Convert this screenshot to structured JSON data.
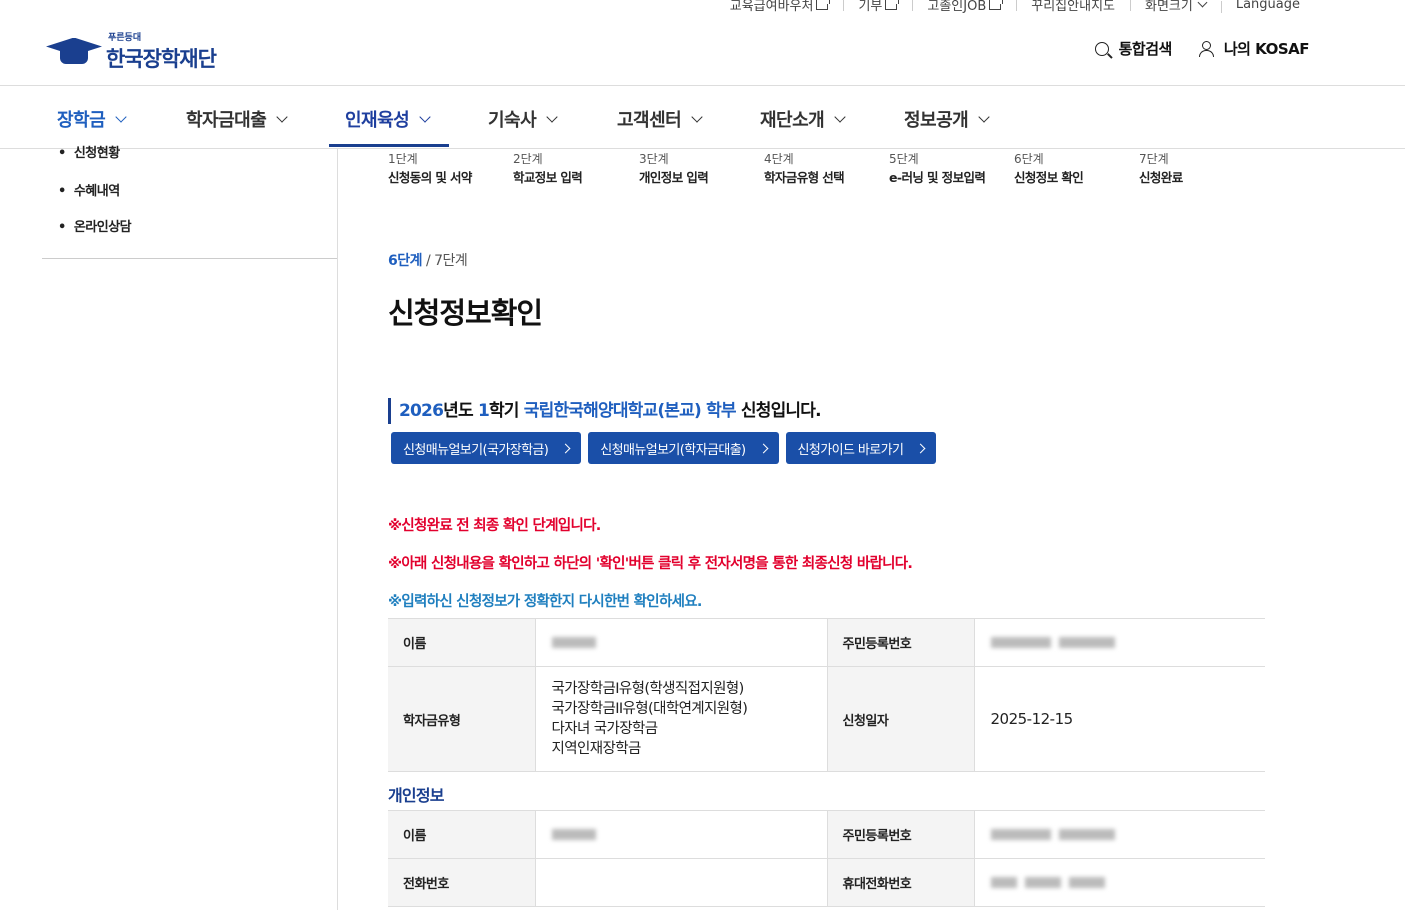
{
  "util_links": {
    "voucher": "교육급여바우처",
    "donate": "기부",
    "job": "고졸인JOB",
    "dreamhouse": "꾸리집안내지도",
    "screen_size": "화면크기",
    "language": "Language"
  },
  "logo": {
    "small": "푸른등대",
    "big": "한국장학재단"
  },
  "header": {
    "search": "통합검색",
    "my": "나의 KOSAF"
  },
  "gnb": {
    "scholarship": "장학금",
    "loan": "학자금대출",
    "talent": "인재육성",
    "dorm": "기숙사",
    "customer": "고객센터",
    "about": "재단소개",
    "disclosure": "정보공개"
  },
  "lnb": {
    "status": "신청현황",
    "benefits": "수혜내역",
    "consult": "온라인상담"
  },
  "steps": [
    {
      "n": "1단계",
      "t": "신청동의 및 서약"
    },
    {
      "n": "2단계",
      "t": "학교정보 입력"
    },
    {
      "n": "3단계",
      "t": "개인정보 입력"
    },
    {
      "n": "4단계",
      "t": "학자금유형 선택"
    },
    {
      "n": "5단계",
      "t": "e-러닝 및 정보입력"
    },
    {
      "n": "6단계",
      "t": "신청정보 확인"
    },
    {
      "n": "7단계",
      "t": "신청완료"
    }
  ],
  "step_indicator": {
    "current": "6단계",
    "total": "/ 7단계"
  },
  "page_title": "신청정보확인",
  "notice": {
    "year": "2026",
    "year_suffix": "년도",
    "term": "1",
    "term_suffix": "학기",
    "school": "국립한국해양대학교(본교) 학부",
    "tail": "신청입니다."
  },
  "buttons": {
    "manual_national": "신청매뉴얼보기(국가장학금)",
    "manual_loan": "신청매뉴얼보기(학자금대출)",
    "guide": "신청가이드 바로가기"
  },
  "warnings": {
    "w1": "※신청완료 전 최종 확인 단계입니다.",
    "w2": "※아래 신청내용을 확인하고 하단의 '확인'버튼 클릭 후 전자서명을 통한 최종신청 바랍니다.",
    "w3": "※입력하신 신청정보가 정확한지 다시한번 확인하세요."
  },
  "summary": {
    "name_label": "이름",
    "rrn_label": "주민등록번호",
    "type_label": "학자금유형",
    "types": [
      "국가장학금I유형(학생직접지원형)",
      "국가장학금II유형(대학연계지원형)",
      "다자녀 국가장학금",
      "지역인재장학금"
    ],
    "date_label": "신청일자",
    "date_value": "2025-12-15"
  },
  "personal": {
    "section_title": "개인정보",
    "name_label": "이름",
    "rrn_label": "주민등록번호",
    "phone_label": "전화번호",
    "mobile_label": "휴대전화번호"
  },
  "colors": {
    "brand": "#1a3f8f",
    "accent": "#1f5fbf",
    "warn_red": "#e2002d",
    "warn_blue": "#1f7fbf"
  }
}
